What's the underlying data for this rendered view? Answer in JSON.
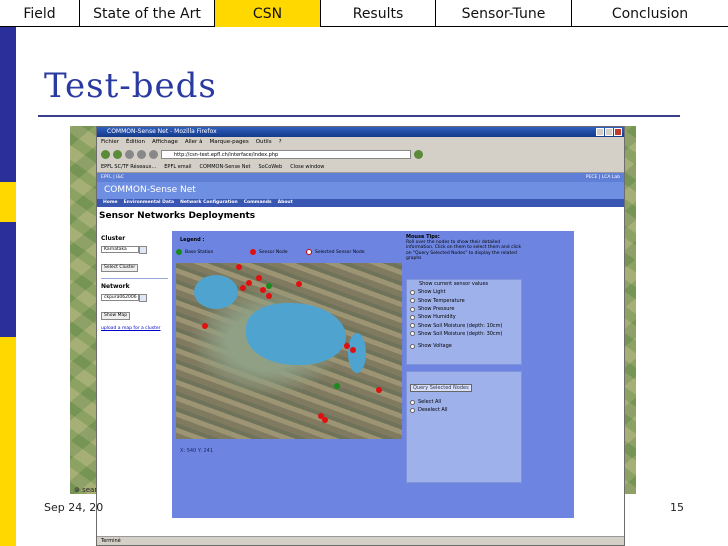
{
  "nav": {
    "tabs": [
      {
        "label": "Field",
        "active": false
      },
      {
        "label": "State of the Art",
        "active": false
      },
      {
        "label": "CSN",
        "active": true
      },
      {
        "label": "Results",
        "active": false
      },
      {
        "label": "Sensor-Tune",
        "active": false
      },
      {
        "label": "Conclusion",
        "active": false
      }
    ]
  },
  "slide": {
    "title": "Test-beds",
    "date": "Sep 24, 20",
    "page_number": "15",
    "map_caption": "search"
  },
  "browser": {
    "window_title": "COMMON-Sense Net - Mozilla Firefox",
    "menu": [
      "Fichier",
      "Édition",
      "Affichage",
      "Aller à",
      "Marque-pages",
      "Outils",
      "?"
    ],
    "url": "http://csn-test.epfl.ch/interface/index.php",
    "bookmarks": [
      "EPFL SC/TF Réseaux...",
      "EPFL email",
      "COMMON-Sense Net",
      "SoCoWeb",
      "Close window"
    ],
    "status": "Terminé"
  },
  "site": {
    "top_left": "EPFL | I&C",
    "top_right": "PECE | LCA Lab",
    "name": "COMMON-Sense Net",
    "nav": [
      "Home",
      "Environmental Data",
      "Network Configuration",
      "Commands",
      "About"
    ],
    "page_heading": "Sensor Networks Deployments",
    "cluster": {
      "label": "Cluster",
      "value": "Karnataka",
      "button": "Select Cluster"
    },
    "network": {
      "label": "Network",
      "value": "ckpura062006",
      "button": "Show Map"
    },
    "upload_link": "upload a map for a cluster",
    "legend": {
      "title": "Legend :",
      "items": [
        {
          "label": "Base Station",
          "color": "#1a8a1a"
        },
        {
          "label": "Sensor Node",
          "color": "#e01010"
        },
        {
          "label": "Selected Sensor Node",
          "color": "#ffffff"
        }
      ]
    },
    "coords": "X: 540 Y: 241",
    "tips": {
      "title": "Mouse Tips:",
      "text": "Roll over the nodes to show their detailed information. Click on them to select them and click on \"Query Selected Nodes\" to display the related graphs"
    },
    "sensor_values": {
      "options": [
        "Show current sensor values",
        "Show Light",
        "Show Temperature",
        "Show Pressure",
        "Show Humidity",
        "Show Soil Moisture (depth: 10cm)",
        "Show Soil Moisture (depth: 30cm)",
        "Show Voltage"
      ]
    },
    "query": {
      "button": "Query Selected Nodes",
      "options": [
        "Select All",
        "Deselect All"
      ]
    }
  },
  "colors": {
    "active_tab": "#ffd800",
    "title": "#2b3aa0",
    "sensor_node": "#e01010",
    "base_station": "#1a8a1a"
  }
}
